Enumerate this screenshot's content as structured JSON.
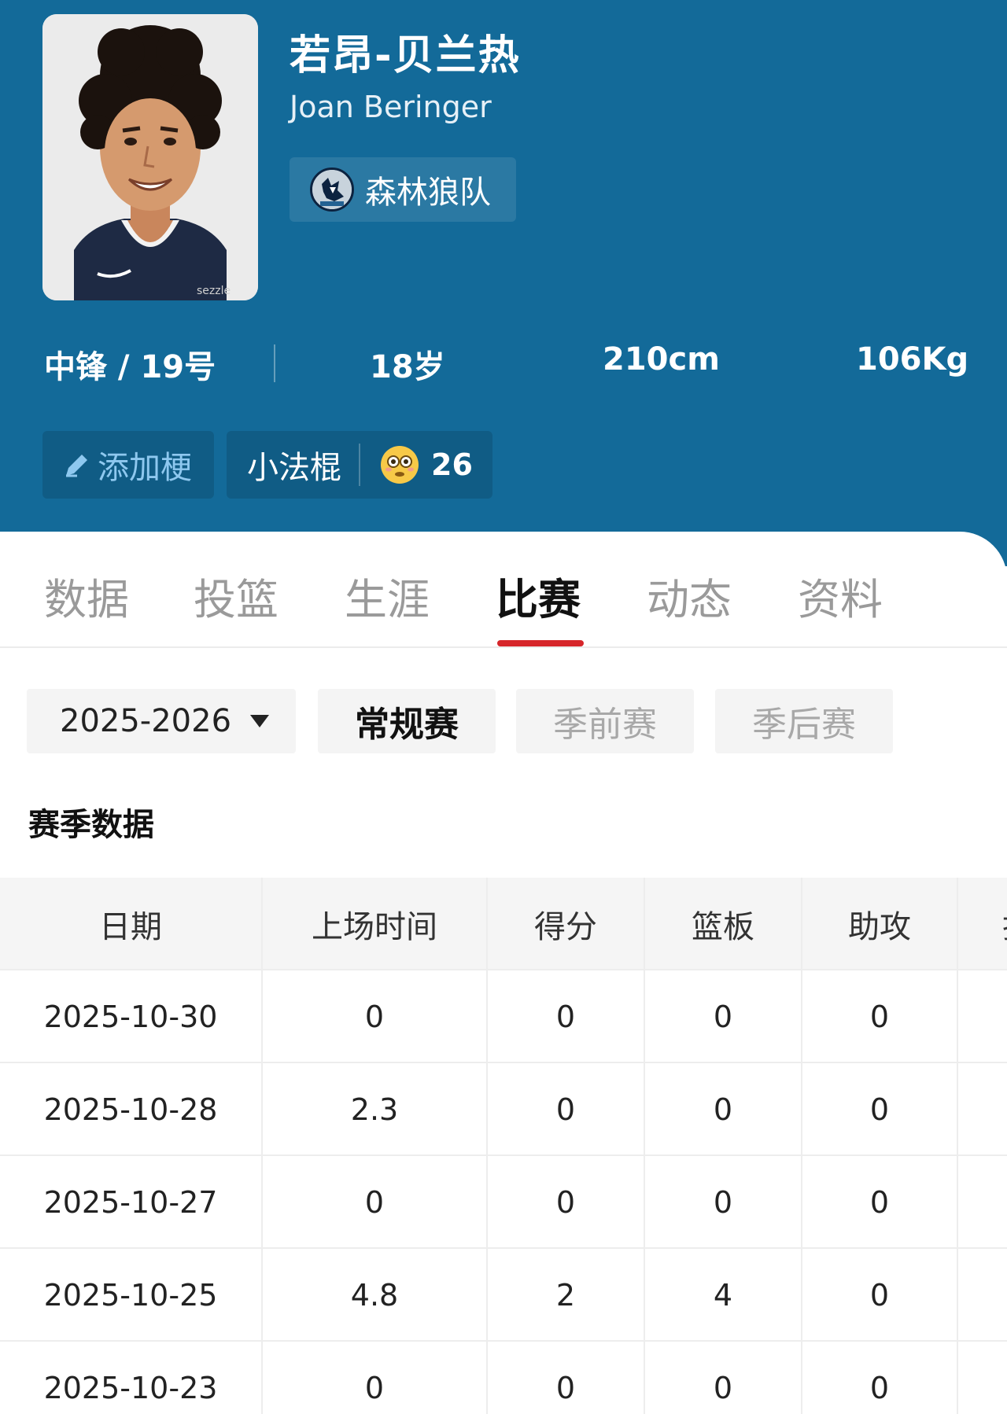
{
  "player": {
    "name_zh": "若昂-贝兰热",
    "name_en": "Joan Beringer",
    "team_name": "森林狼队",
    "team_logo_icon": "wolf-head-icon",
    "position_number": "中锋 / 19号",
    "age": "18岁",
    "height": "210cm",
    "weight": "106Kg",
    "jersey_sponsor": "sezzle"
  },
  "chips": {
    "add_label": "添加梗",
    "add_icon": "pencil-icon",
    "nickname": "小法棍",
    "emoji_icon": "flushed-face-icon",
    "nickname_count": "26"
  },
  "tabs": [
    {
      "label": "数据",
      "active": false
    },
    {
      "label": "投篮",
      "active": false
    },
    {
      "label": "生涯",
      "active": false
    },
    {
      "label": "比赛",
      "active": true
    },
    {
      "label": "动态",
      "active": false
    },
    {
      "label": "资料",
      "active": false
    }
  ],
  "filters": {
    "season": "2025-2026",
    "segments": [
      {
        "label": "常规赛",
        "active": true
      },
      {
        "label": "季前赛",
        "active": false
      },
      {
        "label": "季后赛",
        "active": false
      }
    ]
  },
  "section_title": "赛季数据",
  "table": {
    "headers": [
      "日期",
      "上场时间",
      "得分",
      "篮板",
      "助攻",
      "抢"
    ],
    "rows": [
      [
        "2025-10-30",
        "0",
        "0",
        "0",
        "0"
      ],
      [
        "2025-10-28",
        "2.3",
        "0",
        "0",
        "0"
      ],
      [
        "2025-10-27",
        "0",
        "0",
        "0",
        "0"
      ],
      [
        "2025-10-25",
        "4.8",
        "2",
        "4",
        "0"
      ],
      [
        "2025-10-23",
        "0",
        "0",
        "0",
        "0"
      ]
    ]
  },
  "colors": {
    "header_bg": "#136a99",
    "active_tab_underline": "#d6262a"
  }
}
